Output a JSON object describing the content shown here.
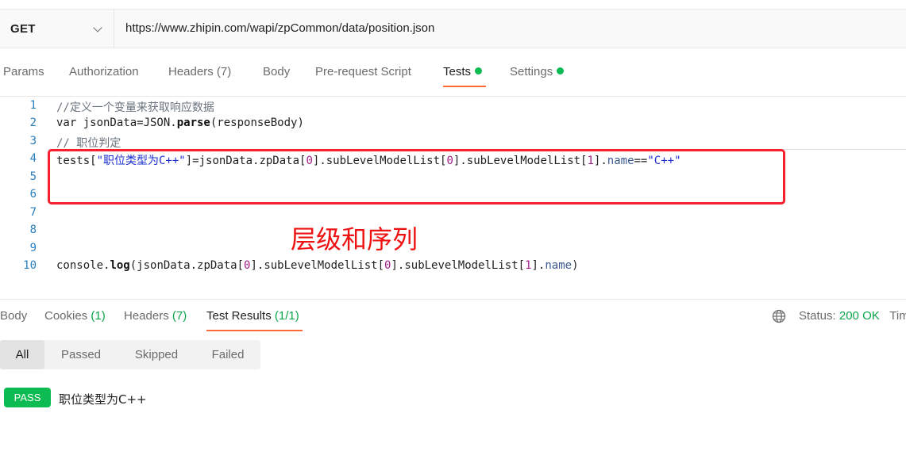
{
  "request": {
    "method": "GET",
    "url": "https://www.zhipin.com/wapi/zpCommon/data/position.json"
  },
  "request_tabs": [
    {
      "label": "Params"
    },
    {
      "label": "Authorization"
    },
    {
      "label": "Headers",
      "count": "(7)"
    },
    {
      "label": "Body"
    },
    {
      "label": "Pre-request Script"
    },
    {
      "label": "Tests",
      "active": true
    },
    {
      "label": "Settings"
    }
  ],
  "editor": {
    "line_numbers": [
      "1",
      "2",
      "3",
      "4",
      "5",
      "6",
      "7",
      "8",
      "9",
      "10"
    ],
    "lines": {
      "l1": "//定义一个变量来获取响应数据",
      "l2a": "var jsonData=JSON.",
      "l2b": "parse",
      "l2c": "(responseBody)",
      "l3": "// 职位判定",
      "l4a": "tests[",
      "l4b": "\"职位类型为C++\"",
      "l4c": "]=jsonData.zpData[",
      "l4d": "0",
      "l4e": "].subLevelModelList[",
      "l4f": "0",
      "l4g": "].subLevelModelList[",
      "l4h": "1",
      "l4i": "].",
      "l4j": "name",
      "l4k": "==",
      "l4l": "\"C++\"",
      "l10a": "console.",
      "l10b": "log",
      "l10c": "(jsonData.zpData[",
      "l10d": "0",
      "l10e": "].subLevelModelList[",
      "l10f": "0",
      "l10g": "].subLevelModelList[",
      "l10h": "1",
      "l10i": "].",
      "l10j": "name",
      "l10k": ")"
    }
  },
  "annotation": "层级和序列",
  "response_tabs": [
    {
      "label": "Body"
    },
    {
      "label": "Cookies",
      "count": "(1)"
    },
    {
      "label": "Headers",
      "count": "(7)"
    },
    {
      "label": "Test Results",
      "count": "(1/1)",
      "active": true
    }
  ],
  "status": {
    "label": "Status:",
    "value": "200 OK",
    "extra": "Tim"
  },
  "filters": [
    "All",
    "Passed",
    "Skipped",
    "Failed"
  ],
  "results": [
    {
      "badge": "PASS",
      "name": "职位类型为C++"
    }
  ],
  "colors": {
    "accent": "#ff6c37",
    "success": "#0cbb52",
    "annotation": "#ee1111"
  }
}
